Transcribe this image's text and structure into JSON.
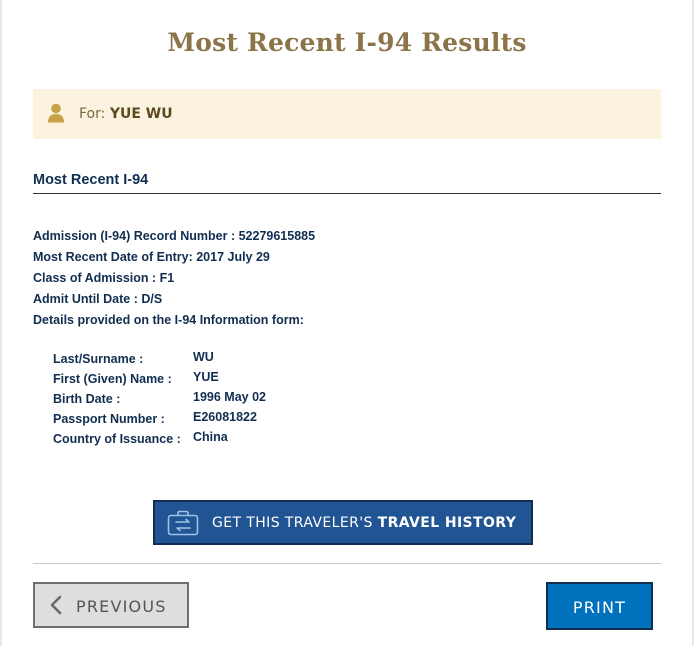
{
  "page": {
    "title": "Most Recent I-94 Results"
  },
  "traveler_banner": {
    "icon": "user-icon",
    "prefix": "For:",
    "name": "YUE WU"
  },
  "section": {
    "title": "Most Recent I-94"
  },
  "record": {
    "admission_number": "Admission (I-94) Record Number : 52279615885",
    "entry_date": "Most Recent Date of Entry: 2017 July 29",
    "class_of_admission": "Class of Admission : F1",
    "admit_until": "Admit Until Date : D/S",
    "details_intro": "Details provided on the I-94 Information form:"
  },
  "details": [
    {
      "label": "Last/Surname :",
      "value": "WU"
    },
    {
      "label": "First (Given) Name :",
      "value": "YUE"
    },
    {
      "label": "Birth Date :",
      "value": "1996 May 02"
    },
    {
      "label": "Passport Number :",
      "value": "E26081822"
    },
    {
      "label": "Country of Issuance :",
      "value": "China"
    }
  ],
  "travel_history_button": {
    "icon": "briefcase-icon",
    "label_prefix": "GET THIS TRAVELER'S ",
    "label_bold": "TRAVEL HISTORY"
  },
  "navigation": {
    "previous_label": "PREVIOUS",
    "previous_icon": "chevron-left-icon",
    "print_label": "PRINT"
  },
  "colors": {
    "title": "#8b7448",
    "banner_bg": "#fbf2df",
    "navy_text": "#112e51",
    "primary_button": "#205493",
    "print_button": "#0071bc",
    "secondary_button": "#dedede"
  }
}
